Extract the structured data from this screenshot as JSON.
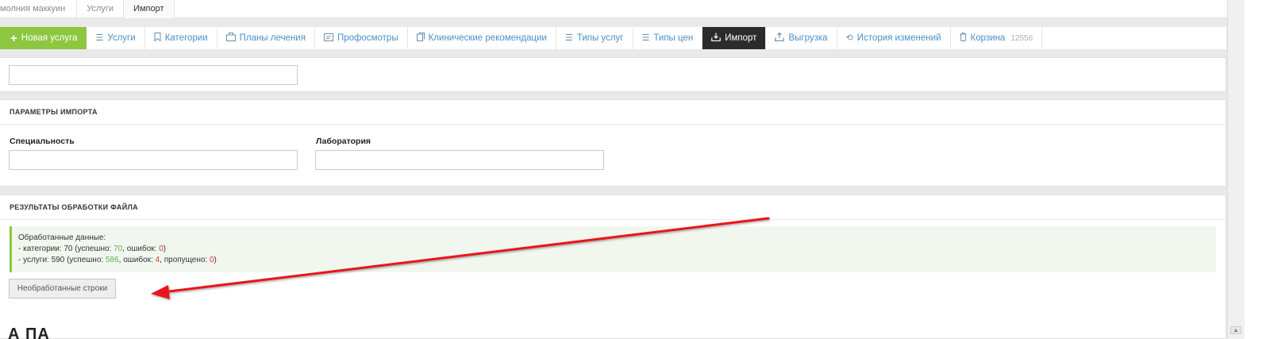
{
  "breadcrumb": [
    "молния маккуин",
    "Услуги",
    "Импорт"
  ],
  "toolbar": {
    "new_service": "Новая услуга",
    "services": "Услуги",
    "categories": "Категории",
    "treatment_plans": "Планы лечения",
    "checkups": "Профосмотры",
    "clinical_recs": "Клинические рекомендации",
    "service_types": "Типы услуг",
    "price_types": "Типы цен",
    "import": "Импорт",
    "export": "Выгрузка",
    "history": "История изменений",
    "trash": "Корзина",
    "trash_count": "12556"
  },
  "file_input": {
    "value": ""
  },
  "import_params": {
    "title": "ПАРАМЕТРЫ ИМПОРТА",
    "specialty_label": "Специальность",
    "specialty_value": "",
    "lab_label": "Лаборатория",
    "lab_value": ""
  },
  "results": {
    "title": "РЕЗУЛЬТАТЫ ОБРАБОТКИ ФАЙЛА",
    "processed_label": "Обработанные данные:",
    "cat_prefix": "- категории: 70 (успешно: ",
    "cat_success": "70",
    "cat_mid": ", ошибок: ",
    "cat_errors": "0",
    "cat_suffix": ")",
    "svc_prefix": "- услуги: 590 (успешно: ",
    "svc_success": "586",
    "svc_mid": ", ошибок: ",
    "svc_errors": "4",
    "svc_mid2": ", пропущено: ",
    "svc_skipped": "0",
    "svc_suffix": ")",
    "unprocessed_button": "Необработанные строки",
    "cut_heading": "А        ПА"
  },
  "colors": {
    "accent_green": "#8dc63f",
    "link_blue": "#4a90c8",
    "active_dark": "#2b2b2b",
    "annotation_red": "#e8141c"
  },
  "icons": [
    "plus-icon",
    "list-icon",
    "bookmark-icon",
    "briefcase-icon",
    "id-card-icon",
    "document-icon",
    "list-icon",
    "list-icon",
    "download-icon",
    "upload-icon",
    "history-icon",
    "trash-icon"
  ]
}
